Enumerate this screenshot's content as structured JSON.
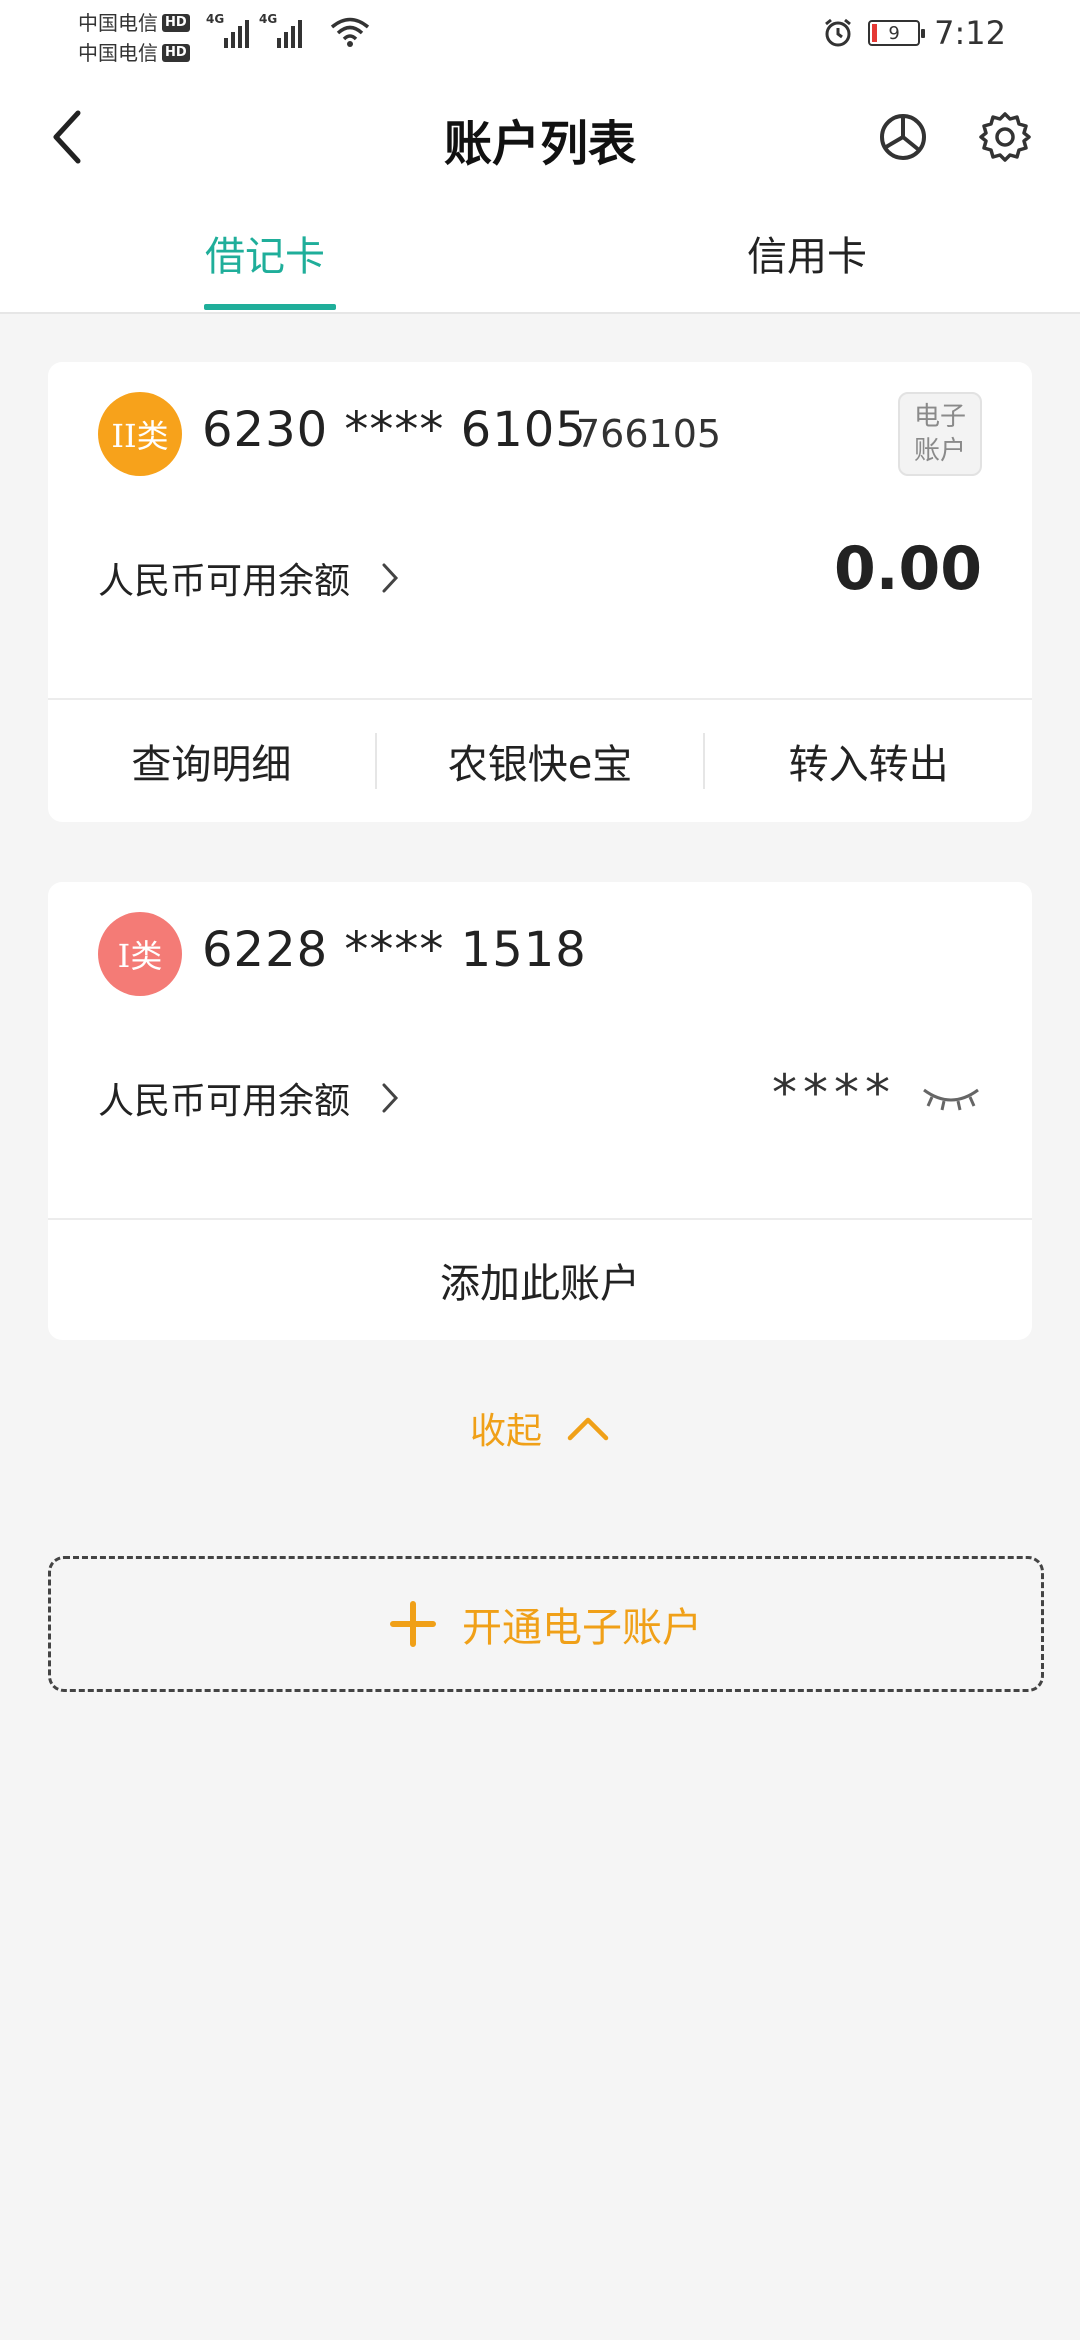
{
  "status_bar": {
    "carrier1": "中国电信",
    "carrier2": "中国电信",
    "hd": "HD",
    "net": "4G",
    "battery_level": "9",
    "time": "7:12"
  },
  "header": {
    "title": "账户列表"
  },
  "tabs": [
    {
      "label": "借记卡",
      "active": true
    },
    {
      "label": "信用卡",
      "active": false
    }
  ],
  "accounts": [
    {
      "type_badge": "II类",
      "badge_color": "#f7a21b",
      "card_number": "6230 **** 6105",
      "suffix": "766105",
      "tag_line1": "电子",
      "tag_line2": "账户",
      "balance_label": "人民币可用余额",
      "balance": "0.00",
      "actions": [
        "查询明细",
        "农银快e宝",
        "转入转出"
      ]
    },
    {
      "type_badge": "I类",
      "badge_color": "#f47b76",
      "card_number": "6228 **** 1518",
      "balance_label": "人民币可用余额",
      "balance_masked": "****",
      "add_label": "添加此账户"
    }
  ],
  "collapse_label": "收起",
  "open_eaccount_label": "开通电子账户",
  "colors": {
    "accent_green": "#1fae9a",
    "accent_orange": "#f0a018"
  }
}
